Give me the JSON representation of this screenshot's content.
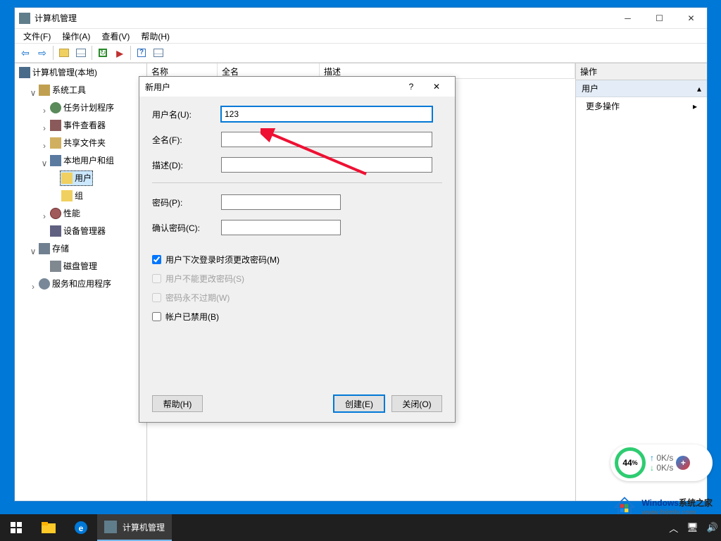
{
  "app": {
    "title": "计算机管理"
  },
  "menu": {
    "file": "文件(F)",
    "action": "操作(A)",
    "view": "查看(V)",
    "help": "帮助(H)"
  },
  "tree": {
    "root": "计算机管理(本地)",
    "system_tools": "系统工具",
    "task_scheduler": "任务计划程序",
    "event_viewer": "事件查看器",
    "shared_folders": "共享文件夹",
    "local_users": "本地用户和组",
    "users": "用户",
    "groups": "组",
    "performance": "性能",
    "device_manager": "设备管理器",
    "storage": "存储",
    "disk_management": "磁盘管理",
    "services": "服务和应用程序"
  },
  "list": {
    "col_name": "名称",
    "col_fullname": "全名",
    "col_desc": "描述"
  },
  "actions": {
    "header": "操作",
    "section": "用户",
    "more": "更多操作"
  },
  "dialog": {
    "title": "新用户",
    "username_label": "用户名(U):",
    "username_value": "123",
    "fullname_label": "全名(F):",
    "desc_label": "描述(D):",
    "password_label": "密码(P):",
    "confirm_label": "确认密码(C):",
    "chk_mustchange": "用户下次登录时须更改密码(M)",
    "chk_cannotchange": "用户不能更改密码(S)",
    "chk_neverexpire": "密码永不过期(W)",
    "chk_disabled": "帐户已禁用(B)",
    "btn_help": "帮助(H)",
    "btn_create": "创建(E)",
    "btn_close": "关闭(O)"
  },
  "speed": {
    "percent": "44",
    "percent_suffix": "%",
    "up": "0K/s",
    "down": "0K/s"
  },
  "watermark": {
    "brand": "Windows",
    "brand2": "系统之家",
    "url": "www.bjjmlv.com"
  },
  "taskbar": {
    "active_app": "计算机管理"
  }
}
